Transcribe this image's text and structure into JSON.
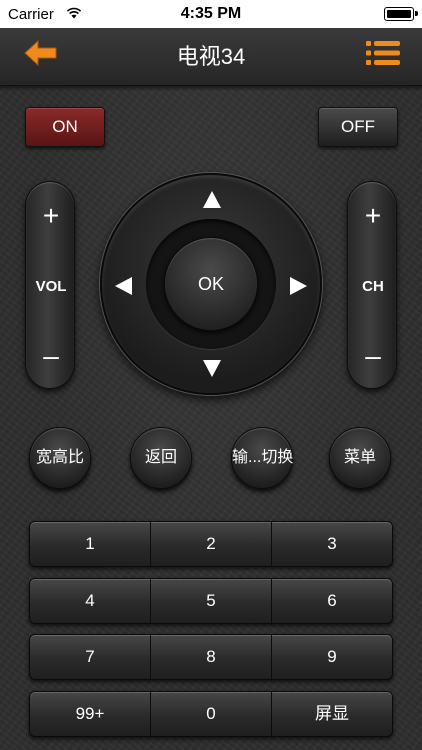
{
  "status_bar": {
    "carrier": "Carrier",
    "time": "4:35 PM"
  },
  "nav": {
    "title": "电视34",
    "accent_color": "#f08a1c"
  },
  "power": {
    "on_label": "ON",
    "off_label": "OFF"
  },
  "volume": {
    "plus": "+",
    "label": "VOL",
    "minus": "–"
  },
  "channel": {
    "plus": "+",
    "label": "CH",
    "minus": "–"
  },
  "dpad": {
    "ok_label": "OK"
  },
  "functions": [
    {
      "label": "宽高比"
    },
    {
      "label": "返回"
    },
    {
      "label": "输...切换"
    },
    {
      "label": "菜单"
    }
  ],
  "numpad": [
    [
      "1",
      "2",
      "3"
    ],
    [
      "4",
      "5",
      "6"
    ],
    [
      "7",
      "8",
      "9"
    ],
    [
      "99+",
      "0",
      "屏显"
    ]
  ]
}
